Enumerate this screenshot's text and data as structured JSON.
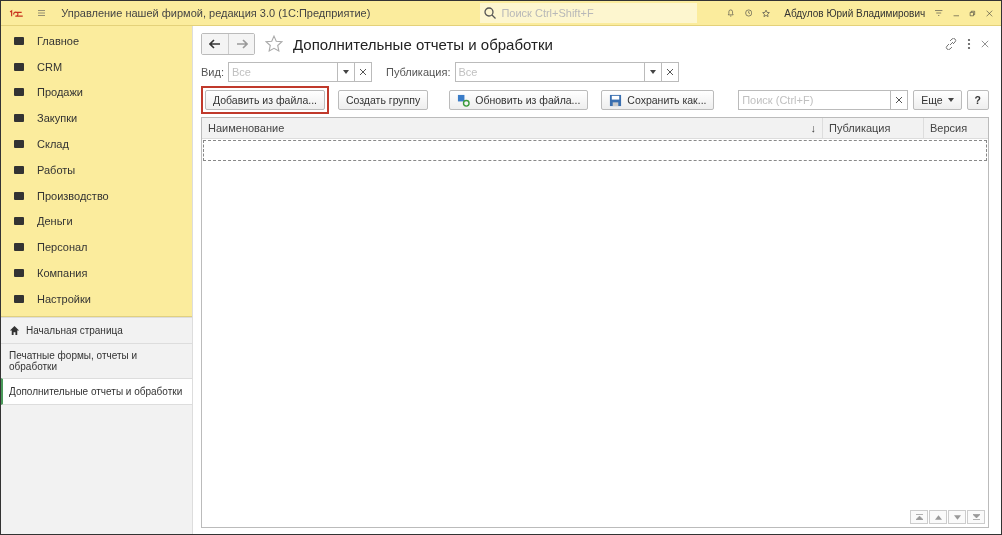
{
  "window": {
    "title": "Управление нашей фирмой, редакция 3.0  (1С:Предприятие)",
    "search": {
      "placeholder": "Поиск Ctrl+Shift+F"
    },
    "user": "Абдулов Юрий Владимирович"
  },
  "sidebar": {
    "sections": [
      {
        "label": "Главное"
      },
      {
        "label": "CRM"
      },
      {
        "label": "Продажи"
      },
      {
        "label": "Закупки"
      },
      {
        "label": "Склад"
      },
      {
        "label": "Работы"
      },
      {
        "label": "Производство"
      },
      {
        "label": "Деньги"
      },
      {
        "label": "Персонал"
      },
      {
        "label": "Компания"
      },
      {
        "label": "Настройки"
      }
    ],
    "open_pages": [
      {
        "label": "Начальная страница",
        "kind": "home",
        "selected": false
      },
      {
        "label": "Печатные формы, отчеты и обработки",
        "kind": "page",
        "selected": false
      },
      {
        "label": "Дополнительные отчеты и обработки",
        "kind": "page",
        "selected": true
      }
    ]
  },
  "form": {
    "title": "Дополнительные отчеты и обработки",
    "filters": [
      {
        "label": "Вид:",
        "placeholder": "Все"
      },
      {
        "label": "Публикация:",
        "placeholder": "Все"
      }
    ],
    "buttons": [
      {
        "label": "Добавить из файла...",
        "kind": "plain",
        "highlighted": true
      },
      {
        "label": "Создать группу",
        "kind": "plain",
        "highlighted": false
      },
      {
        "label": "Обновить из файла...",
        "kind": "refresh",
        "highlighted": false
      },
      {
        "label": "Сохранить как...",
        "kind": "save",
        "highlighted": false
      }
    ],
    "search": {
      "placeholder": "Поиск (Ctrl+F)"
    },
    "more_button": "Еще",
    "help_button": "?",
    "table": {
      "columns": [
        {
          "label": "Наименование",
          "sort": "↓"
        },
        {
          "label": "Публикация"
        },
        {
          "label": "Версия"
        }
      ]
    }
  }
}
